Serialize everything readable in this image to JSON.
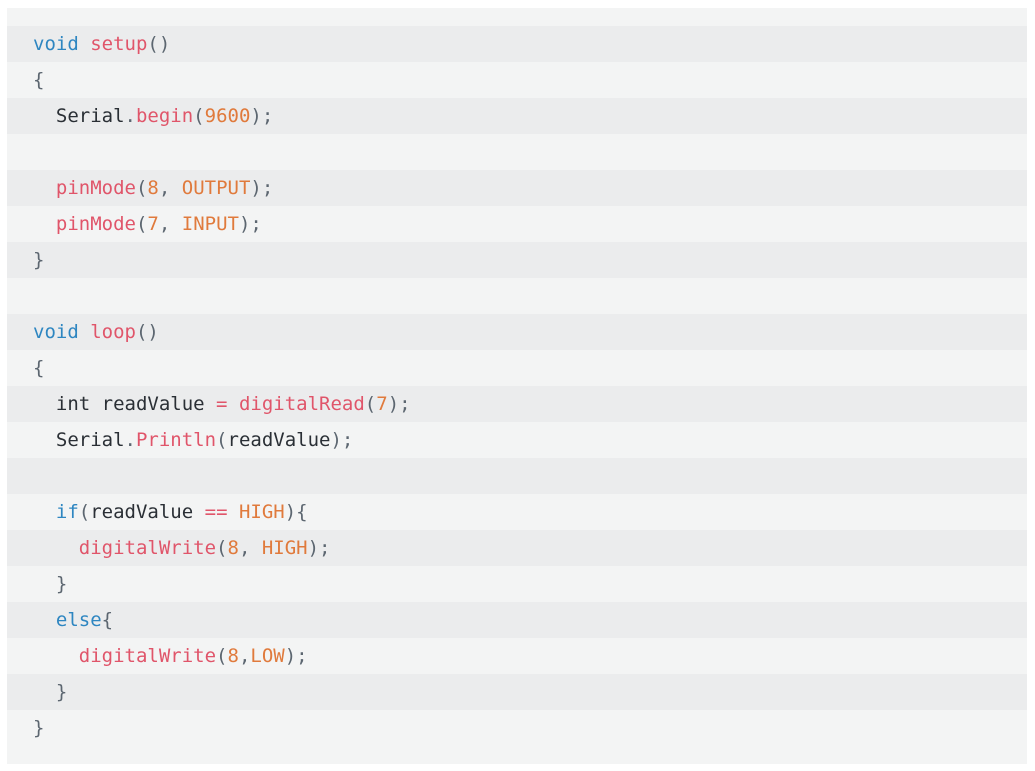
{
  "code": {
    "language": "arduino",
    "lines": [
      [
        [
          "kw",
          "void"
        ],
        [
          "plain",
          " "
        ],
        [
          "fn",
          "setup"
        ],
        [
          "punc",
          "()"
        ]
      ],
      [
        [
          "punc",
          "{"
        ]
      ],
      [
        [
          "plain",
          "  Serial"
        ],
        [
          "punc",
          "."
        ],
        [
          "fn",
          "begin"
        ],
        [
          "punc",
          "("
        ],
        [
          "num",
          "9600"
        ],
        [
          "punc",
          ");"
        ]
      ],
      [],
      [
        [
          "plain",
          "  "
        ],
        [
          "fn",
          "pinMode"
        ],
        [
          "punc",
          "("
        ],
        [
          "num",
          "8"
        ],
        [
          "punc",
          ", "
        ],
        [
          "const",
          "OUTPUT"
        ],
        [
          "punc",
          ");"
        ]
      ],
      [
        [
          "plain",
          "  "
        ],
        [
          "fn",
          "pinMode"
        ],
        [
          "punc",
          "("
        ],
        [
          "num",
          "7"
        ],
        [
          "punc",
          ", "
        ],
        [
          "const",
          "INPUT"
        ],
        [
          "punc",
          ");"
        ]
      ],
      [
        [
          "punc",
          "}"
        ]
      ],
      [],
      [
        [
          "kw",
          "void"
        ],
        [
          "plain",
          " "
        ],
        [
          "fn",
          "loop"
        ],
        [
          "punc",
          "()"
        ]
      ],
      [
        [
          "punc",
          "{"
        ]
      ],
      [
        [
          "plain",
          "  int readValue "
        ],
        [
          "op",
          "="
        ],
        [
          "plain",
          " "
        ],
        [
          "fn",
          "digitalRead"
        ],
        [
          "punc",
          "("
        ],
        [
          "num",
          "7"
        ],
        [
          "punc",
          ");"
        ]
      ],
      [
        [
          "plain",
          "  Serial"
        ],
        [
          "punc",
          "."
        ],
        [
          "fn",
          "Println"
        ],
        [
          "punc",
          "("
        ],
        [
          "plain",
          "readValue"
        ],
        [
          "punc",
          ");"
        ]
      ],
      [],
      [
        [
          "plain",
          "  "
        ],
        [
          "kw",
          "if"
        ],
        [
          "punc",
          "("
        ],
        [
          "plain",
          "readValue "
        ],
        [
          "op",
          "=="
        ],
        [
          "plain",
          " "
        ],
        [
          "const",
          "HIGH"
        ],
        [
          "punc",
          "){"
        ]
      ],
      [
        [
          "plain",
          "    "
        ],
        [
          "fn",
          "digitalWrite"
        ],
        [
          "punc",
          "("
        ],
        [
          "num",
          "8"
        ],
        [
          "punc",
          ", "
        ],
        [
          "const",
          "HIGH"
        ],
        [
          "punc",
          ");"
        ]
      ],
      [
        [
          "plain",
          "  "
        ],
        [
          "punc",
          "}"
        ]
      ],
      [
        [
          "plain",
          "  "
        ],
        [
          "kw",
          "else"
        ],
        [
          "punc",
          "{"
        ]
      ],
      [
        [
          "plain",
          "    "
        ],
        [
          "fn",
          "digitalWrite"
        ],
        [
          "punc",
          "("
        ],
        [
          "num",
          "8"
        ],
        [
          "punc",
          ","
        ],
        [
          "const",
          "LOW"
        ],
        [
          "punc",
          ");"
        ]
      ],
      [
        [
          "plain",
          "  "
        ],
        [
          "punc",
          "}"
        ]
      ],
      [
        [
          "punc",
          "}"
        ]
      ]
    ]
  }
}
